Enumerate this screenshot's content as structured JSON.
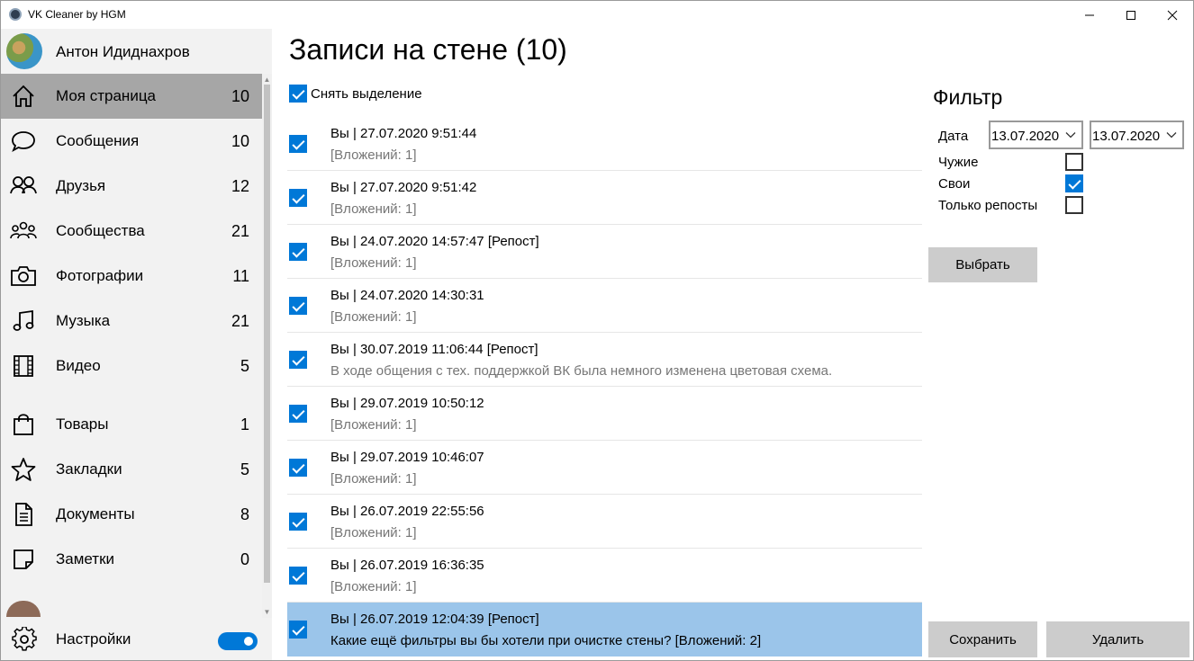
{
  "window": {
    "title": "VK Cleaner by HGM"
  },
  "profile": {
    "name": "Антон Идиднахров"
  },
  "nav": [
    {
      "label": "Моя страница",
      "count": "10",
      "icon": "home-icon"
    },
    {
      "label": "Сообщения",
      "count": "10",
      "icon": "chat-icon"
    },
    {
      "label": "Друзья",
      "count": "12",
      "icon": "friends-icon"
    },
    {
      "label": "Сообщества",
      "count": "21",
      "icon": "groups-icon"
    },
    {
      "label": "Фотографии",
      "count": "11",
      "icon": "camera-icon"
    },
    {
      "label": "Музыка",
      "count": "21",
      "icon": "music-icon"
    },
    {
      "label": "Видео",
      "count": "5",
      "icon": "film-icon"
    },
    {
      "label": "Товары",
      "count": "1",
      "icon": "bag-icon"
    },
    {
      "label": "Закладки",
      "count": "5",
      "icon": "star-icon"
    },
    {
      "label": "Документы",
      "count": "8",
      "icon": "document-icon"
    },
    {
      "label": "Заметки",
      "count": "0",
      "icon": "note-icon"
    }
  ],
  "settings": {
    "label": "Настройки",
    "toggle_on": true
  },
  "main": {
    "title": "Записи на стене (10)",
    "deselect_label": "Снять выделение",
    "posts": [
      {
        "head": "Вы | 27.07.2020 9:51:44",
        "sub": "[Вложений: 1]",
        "checked": true
      },
      {
        "head": "Вы | 27.07.2020 9:51:42",
        "sub": "[Вложений: 1]",
        "checked": true
      },
      {
        "head": "Вы | 24.07.2020 14:57:47 [Репост]",
        "sub": "[Вложений: 1]",
        "checked": true
      },
      {
        "head": "Вы | 24.07.2020 14:30:31",
        "sub": "[Вложений: 1]",
        "checked": true
      },
      {
        "head": "Вы | 30.07.2019 11:06:44 [Репост]",
        "sub": "В ходе общения с тех. поддержкой ВК была немного изменена цветовая схема.",
        "checked": true
      },
      {
        "head": "Вы | 29.07.2019 10:50:12",
        "sub": "[Вложений: 1]",
        "checked": true
      },
      {
        "head": "Вы | 29.07.2019 10:46:07",
        "sub": "[Вложений: 1]",
        "checked": true
      },
      {
        "head": "Вы | 26.07.2019 22:55:56",
        "sub": "[Вложений: 1]",
        "checked": true
      },
      {
        "head": "Вы | 26.07.2019 16:36:35",
        "sub": "[Вложений: 1]",
        "checked": true
      },
      {
        "head": "Вы | 26.07.2019 12:04:39 [Репост]",
        "sub": "Какие ещё фильтры вы бы хотели при очистке стены? [Вложений: 2]",
        "checked": true
      }
    ]
  },
  "filter": {
    "title": "Фильтр",
    "date_label": "Дата",
    "date_from": "13.07.2020",
    "date_to": "13.07.2020",
    "others_label": "Чужие",
    "others_checked": false,
    "own_label": "Свои",
    "own_checked": true,
    "reposts_label": "Только репосты",
    "reposts_checked": false,
    "select_button": "Выбрать",
    "save_button": "Сохранить",
    "delete_button": "Удалить"
  },
  "colors": {
    "accent": "#0078d7",
    "selected_nav": "#a6a6a6",
    "highlight_row": "#9bc5ea",
    "button": "#cccccc"
  }
}
